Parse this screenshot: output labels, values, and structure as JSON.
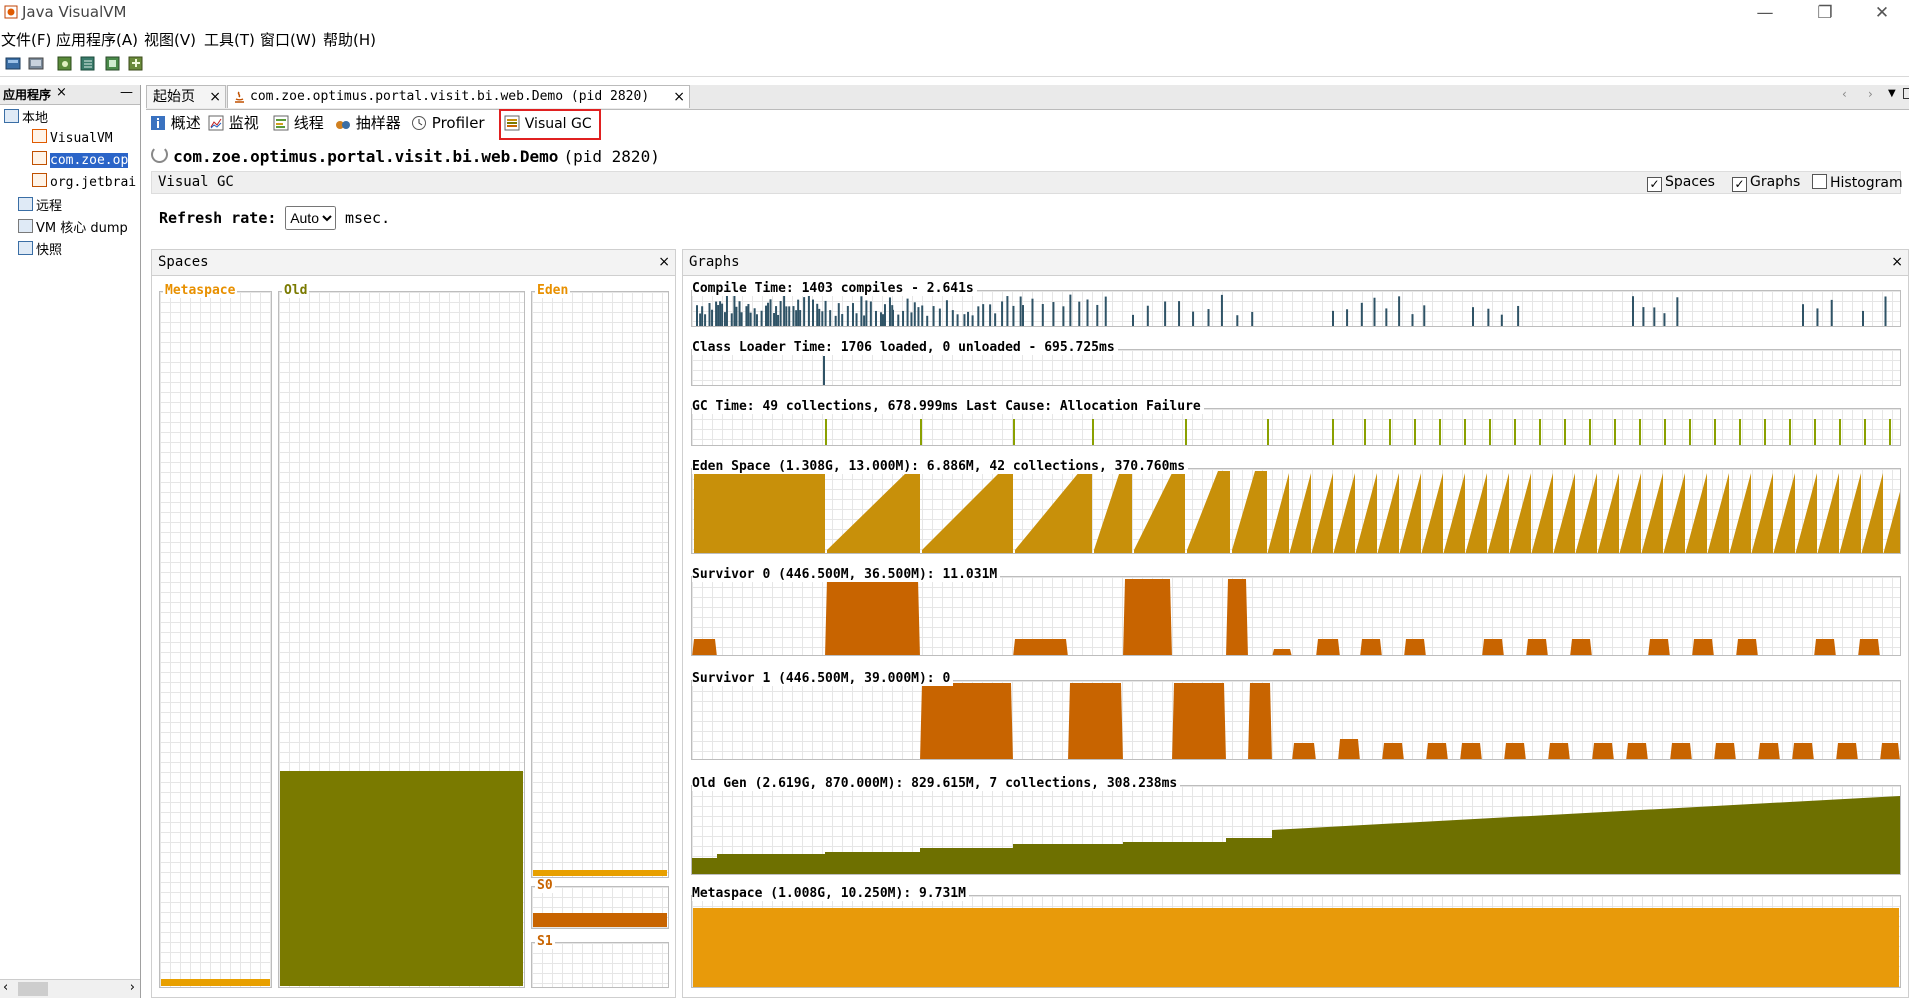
{
  "window": {
    "title": "Java VisualVM",
    "minimize": "—",
    "restore": "❐",
    "close": "✕"
  },
  "menu": [
    "文件(F)",
    "应用程序(A)",
    "视图(V)",
    "工具(T)",
    "窗口(W)",
    "帮助(H)"
  ],
  "left_panel": {
    "title": "应用程序",
    "close": "×",
    "minimize": "—",
    "tree": [
      {
        "label": "本地",
        "indent": 0,
        "icon": "computer-icon"
      },
      {
        "label": "VisualVM",
        "indent": 2,
        "icon": "visualvm-icon"
      },
      {
        "label": "com.zoe.op",
        "indent": 2,
        "icon": "java-app-icon",
        "selected": true
      },
      {
        "label": "org.jetbrai",
        "indent": 2,
        "icon": "java-app-icon"
      },
      {
        "label": "远程",
        "indent": 1,
        "icon": "remote-icon"
      },
      {
        "label": "VM 核心 dump",
        "indent": 1,
        "icon": "coredump-icon"
      },
      {
        "label": "快照",
        "indent": 1,
        "icon": "snapshot-icon"
      }
    ]
  },
  "doc_tabs": [
    {
      "label": "起始页",
      "close": "×"
    },
    {
      "label": "com.zoe.optimus.portal.visit.bi.web.Demo (pid 2820)",
      "close": "×",
      "active": true
    }
  ],
  "sub_tabs": [
    {
      "label": "概述",
      "icon": "info-icon"
    },
    {
      "label": "监视",
      "icon": "monitor-icon"
    },
    {
      "label": "线程",
      "icon": "threads-icon"
    },
    {
      "label": "抽样器",
      "icon": "sampler-icon"
    },
    {
      "label": "Profiler",
      "icon": "profiler-icon"
    },
    {
      "label": "Visual GC",
      "icon": "visualgc-icon",
      "active": true
    }
  ],
  "heading": {
    "app": "com.zoe.optimus.portal.visit.bi.web.Demo",
    "pid": "(pid 2820)"
  },
  "vgc_bar": {
    "title": "Visual GC",
    "spaces": {
      "label": "Spaces",
      "checked": true
    },
    "graphs": {
      "label": "Graphs",
      "checked": true
    },
    "histogram": {
      "label": "Histogram",
      "checked": false
    }
  },
  "refresh": {
    "label": "Refresh rate:",
    "value": "Auto",
    "unit": "msec."
  },
  "spaces_panel": {
    "title": "Spaces",
    "close": "×",
    "metaspace": {
      "label": "Metaspace",
      "fill": 0.01,
      "color": "#e8a000"
    },
    "old": {
      "label": "Old",
      "fill": 0.31,
      "color": "#7a7a00"
    },
    "eden": {
      "label": "Eden",
      "fill": 0.01,
      "color": "#e8a000"
    },
    "s0": {
      "label": "S0",
      "fill": 0.35,
      "color": "#c86400"
    },
    "s1": {
      "label": "S1",
      "fill": 0.0,
      "color": "#c86400"
    }
  },
  "graphs_panel": {
    "title": "Graphs",
    "close": "×",
    "graphs": [
      {
        "label": "Compile Time: 1403 compiles - 2.641s",
        "color": "#2f5366"
      },
      {
        "label": "Class Loader Time: 1706 loaded, 0 unloaded - 695.725ms",
        "color": "#2f5366"
      },
      {
        "label": "GC Time: 49 collections, 678.999ms Last Cause: Allocation Failure",
        "color": "#8aa000"
      },
      {
        "label": "Eden Space (1.308G, 13.000M): 6.886M, 42 collections, 370.760ms",
        "color": "#c8900a"
      },
      {
        "label": "Survivor 0 (446.500M, 36.500M): 11.031M",
        "color": "#c86400"
      },
      {
        "label": "Survivor 1 (446.500M, 39.000M): 0",
        "color": "#c86400"
      },
      {
        "label": "Old Gen (2.619G, 870.000M): 829.615M, 7 collections, 308.238ms",
        "color": "#6e7000"
      },
      {
        "label": "Metaspace (1.008G, 10.250M): 9.731M",
        "color": "#e89a0a"
      }
    ]
  }
}
